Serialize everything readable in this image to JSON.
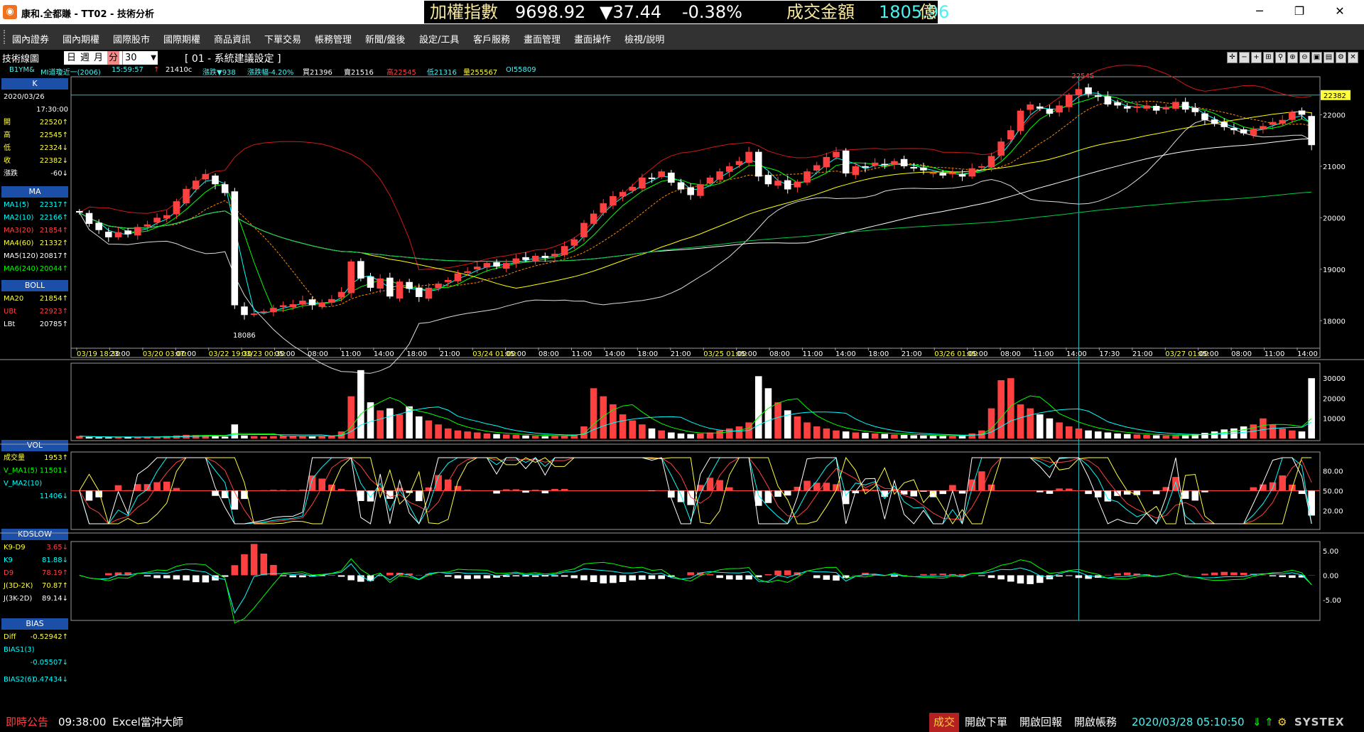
{
  "window": {
    "title": "康和.全都賺 - TT02 - 技術分析",
    "icon": "app-logo-icon",
    "minimize": "─",
    "maximize": "❐",
    "close": "✕"
  },
  "ticker": {
    "name": "加權指數",
    "value": "9698.92",
    "change": "▼37.44",
    "pct": "-0.38%",
    "turnover_label": "成交金額",
    "turnover": "1805.96",
    "unit": "億"
  },
  "menu": [
    "國內證券",
    "國內期權",
    "國際股市",
    "國際期權",
    "商品資訊",
    "下單交易",
    "帳務管理",
    "新聞/盤後",
    "設定/工具",
    "客戶服務",
    "畫面管理",
    "畫面操作",
    "檢視/說明"
  ],
  "toolbar": {
    "label": "技術線圖",
    "periods": [
      "日",
      "週",
      "月",
      "分"
    ],
    "interval": "30",
    "setting": "[ 01 - 系統建議設定 ]"
  },
  "quote": {
    "symbol": "B1YM&",
    "name": "MI道瓊近一(2006)",
    "time": "15:59:57",
    "arrow": "↑",
    "last": "21410c",
    "chg": "漲跌▼938",
    "chg_pct": "漲跌幅-4.20%",
    "bid": "買21396",
    "ask": "賣21516",
    "high": "高22545",
    "low": "低21316",
    "volume": "量255567",
    "oi": "OI55809"
  },
  "panel": {
    "k": {
      "title": "K",
      "date": "2020/03/26",
      "time": "17:30:00",
      "rows": [
        {
          "label": "開",
          "value": "22520↑"
        },
        {
          "label": "高",
          "value": "22545↑"
        },
        {
          "label": "低",
          "value": "22324↓"
        },
        {
          "label": "收",
          "value": "22382↓"
        },
        {
          "label": "漲跌",
          "value": "-60↓"
        }
      ]
    },
    "ma": {
      "title": "MA",
      "rows": [
        {
          "label": "MA1(5)",
          "value": "22317↑"
        },
        {
          "label": "MA2(10)",
          "value": "22166↑"
        },
        {
          "label": "MA3(20)",
          "value": "21854↑"
        },
        {
          "label": "MA4(60)",
          "value": "21332↑"
        },
        {
          "label": "MA5(120)",
          "value": "20817↑"
        },
        {
          "label": "MA6(240)",
          "value": "20044↑"
        }
      ]
    },
    "boll": {
      "title": "BOLL",
      "rows": [
        {
          "label": "MA20",
          "value": "21854↑"
        },
        {
          "label": "UBt",
          "value": "22923↑"
        },
        {
          "label": "LBt",
          "value": "20785↑"
        }
      ]
    },
    "vol": {
      "title": "VOL",
      "rows": [
        {
          "label": "成交量",
          "value": "1953↑"
        },
        {
          "label": "V_MA1(5)",
          "value": "11501↓"
        },
        {
          "label": "V_MA2(10)",
          "value": ""
        },
        {
          "label": "",
          "value": "11406↓"
        }
      ]
    },
    "kd": {
      "title": "KDSLOW",
      "rows": [
        {
          "label": "K9-D9",
          "value": "3.65↓"
        },
        {
          "label": "K9",
          "value": "81.88↓"
        },
        {
          "label": "D9",
          "value": "78.19↑"
        },
        {
          "label": "J(3D-2K)",
          "value": "70.87↑"
        },
        {
          "label": "J(3K-2D)",
          "value": "89.14↓"
        }
      ]
    },
    "bias": {
      "title": "BIAS",
      "rows": [
        {
          "label": "Diff",
          "value": "-0.52942↑"
        },
        {
          "label": "BIAS1(3)",
          "value": ""
        },
        {
          "label": "",
          "value": "-0.05507↓"
        },
        {
          "label": "BIAS2(6)",
          "value": "0.47434↓"
        }
      ]
    }
  },
  "chart_data": [
    {
      "type": "candlestick",
      "title": "K",
      "y_ticks": [
        "22000",
        "21000",
        "20000",
        "19000",
        "18000"
      ],
      "ylim": [
        17700,
        22600
      ],
      "crosshair_value": "22382",
      "high_label": "22545",
      "low_label": "18086",
      "x_ticks": [
        "03/19 18:30",
        "23:00",
        "03/20 03:00",
        "07:00",
        "03/22 19:30",
        "03/23 00:30",
        "05:00",
        "08:00",
        "11:00",
        "14:00",
        "18:00",
        "21:00",
        "03/24 01:00",
        "05:00",
        "08:00",
        "11:00",
        "14:00",
        "18:00",
        "21:00",
        "03/25 01:00",
        "05:00",
        "08:00",
        "11:00",
        "14:00",
        "18:00",
        "21:00",
        "03/26 01:00",
        "05:00",
        "08:00",
        "11:00",
        "14:00",
        "17:30",
        "21:00",
        "03/27 01:00",
        "05:00",
        "08:00",
        "11:00",
        "14:00"
      ],
      "closes": [
        20100,
        19880,
        19760,
        19620,
        19720,
        19680,
        19820,
        19870,
        20000,
        20050,
        20320,
        20560,
        20720,
        20850,
        20650,
        20480,
        18300,
        18110,
        18140,
        18180,
        18250,
        18300,
        18320,
        18390,
        18300,
        18350,
        18420,
        18560,
        19150,
        18820,
        18640,
        18820,
        18470,
        18760,
        18620,
        18460,
        18640,
        18720,
        18790,
        18920,
        18960,
        19050,
        19120,
        19050,
        19120,
        19210,
        19180,
        19260,
        19220,
        19300,
        19450,
        19580,
        19900,
        20080,
        20280,
        20420,
        20500,
        20600,
        20780,
        20760,
        20900,
        20680,
        20550,
        20440,
        20650,
        20780,
        20900,
        21000,
        21100,
        21280,
        20800,
        20650,
        20720,
        20550,
        20700,
        20900,
        21020,
        21180,
        21280,
        20860,
        21000,
        20980,
        21070,
        21020,
        21100,
        21000,
        20960,
        20920,
        20880,
        20820,
        20880,
        20800,
        20960,
        21000,
        21200,
        21480,
        21700,
        22080,
        22200,
        22120,
        22020,
        22180,
        22380,
        22500,
        22400,
        22350,
        22200,
        22180,
        22120,
        22160,
        22180,
        22080,
        22150,
        22250,
        22100,
        22050,
        21900,
        21820,
        21760,
        21700,
        21640,
        21720,
        21780,
        21860,
        21900,
        22050,
        22000,
        21410
      ],
      "volume_ticks": [
        "30000",
        "20000",
        "10000"
      ],
      "volumes": [
        1200,
        800,
        600,
        500,
        700,
        900,
        600,
        800,
        900,
        1200,
        1500,
        1800,
        1700,
        1600,
        1200,
        900,
        7000,
        1500,
        1200,
        1000,
        1200,
        1400,
        1300,
        1100,
        1000,
        1200,
        1500,
        3500,
        21000,
        34000,
        18000,
        14000,
        15000,
        12000,
        16000,
        11000,
        9000,
        7000,
        5000,
        4000,
        3500,
        3000,
        2500,
        2200,
        2000,
        1800,
        1500,
        1400,
        1200,
        1300,
        1500,
        2000,
        6000,
        25000,
        21000,
        17000,
        12000,
        9000,
        7000,
        5000,
        4000,
        3000,
        2500,
        2200,
        2500,
        3000,
        4000,
        5000,
        6000,
        8000,
        31000,
        25000,
        18000,
        14000,
        11000,
        8000,
        6000,
        5000,
        4000,
        3500,
        3000,
        2800,
        2500,
        2300,
        2000,
        1800,
        1600,
        1500,
        1400,
        1300,
        1200,
        1500,
        2500,
        4000,
        15000,
        29000,
        30000,
        17000,
        15000,
        12000,
        10000,
        8000,
        6000,
        5000,
        4000,
        3500,
        3000,
        2500,
        2200,
        2000,
        1800,
        1600,
        1500,
        1500,
        1800,
        2200,
        2800,
        3500,
        4500,
        5000,
        6000,
        7000,
        10000,
        7000,
        5000,
        4000,
        3500,
        30000
      ],
      "kd_ticks": [
        "80.00",
        "50.00",
        "20.00"
      ],
      "bias_ticks": [
        "5.00",
        "0.00",
        "-5.00"
      ]
    }
  ],
  "statusbar": {
    "news_label": "即時公告",
    "news_time": "09:38:00",
    "news_text": "Excel當沖大師",
    "deal": "成交",
    "btn_order": "開啟下單",
    "btn_report": "開啟回報",
    "btn_account": "開啟帳務",
    "datetime": "2020/03/28 05:10:50",
    "brand": "SYSTEX"
  },
  "colors": {
    "up": "#ff4040",
    "down": "#ffffff",
    "ma1": "#00ffff",
    "ma2": "#00ff00",
    "ma3": "#ff8c00",
    "ma4": "#ffff00",
    "ma5": "#ffffff",
    "ma6": "#00cc44",
    "boll": "#d01818"
  }
}
